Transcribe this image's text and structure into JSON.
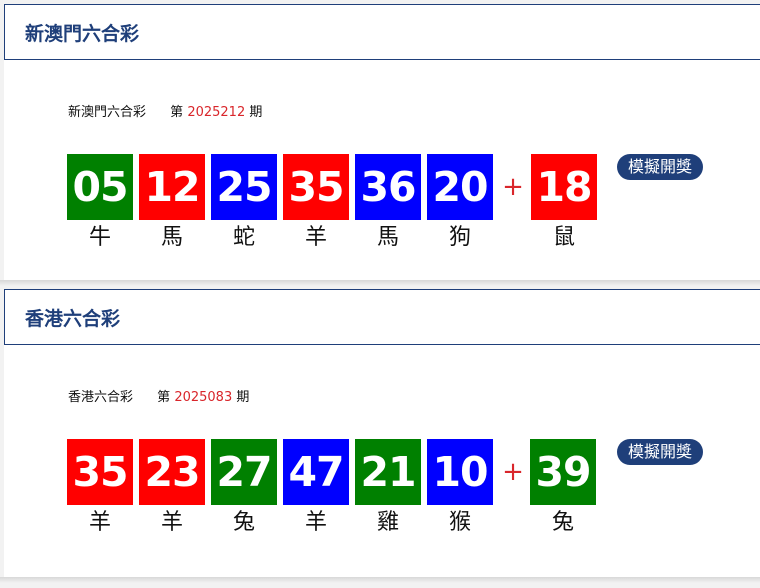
{
  "colors": {
    "red": "#ff0000",
    "blue": "#0000ff",
    "green": "#008000",
    "header_text": "#1f3f7a",
    "issue_number": "#d9262b"
  },
  "sections": [
    {
      "title": "新澳門六合彩",
      "lottery_name": "新澳門六合彩",
      "issue_prefix": "第",
      "issue_number": "2025212",
      "issue_suffix": "期",
      "plus": "+",
      "sim_button": "模擬開獎",
      "balls": [
        {
          "number": "05",
          "zodiac": "牛",
          "color": "green"
        },
        {
          "number": "12",
          "zodiac": "馬",
          "color": "red"
        },
        {
          "number": "25",
          "zodiac": "蛇",
          "color": "blue"
        },
        {
          "number": "35",
          "zodiac": "羊",
          "color": "red"
        },
        {
          "number": "36",
          "zodiac": "馬",
          "color": "blue"
        },
        {
          "number": "20",
          "zodiac": "狗",
          "color": "blue"
        }
      ],
      "special_ball": {
        "number": "18",
        "zodiac": "鼠",
        "color": "red"
      }
    },
    {
      "title": "香港六合彩",
      "lottery_name": "香港六合彩",
      "issue_prefix": "第",
      "issue_number": "2025083",
      "issue_suffix": "期",
      "plus": "+",
      "sim_button": "模擬開獎",
      "balls": [
        {
          "number": "35",
          "zodiac": "羊",
          "color": "red"
        },
        {
          "number": "23",
          "zodiac": "羊",
          "color": "red"
        },
        {
          "number": "27",
          "zodiac": "兔",
          "color": "green"
        },
        {
          "number": "47",
          "zodiac": "羊",
          "color": "blue"
        },
        {
          "number": "21",
          "zodiac": "雞",
          "color": "green"
        },
        {
          "number": "10",
          "zodiac": "猴",
          "color": "blue"
        }
      ],
      "special_ball": {
        "number": "39",
        "zodiac": "兔",
        "color": "green"
      }
    }
  ]
}
